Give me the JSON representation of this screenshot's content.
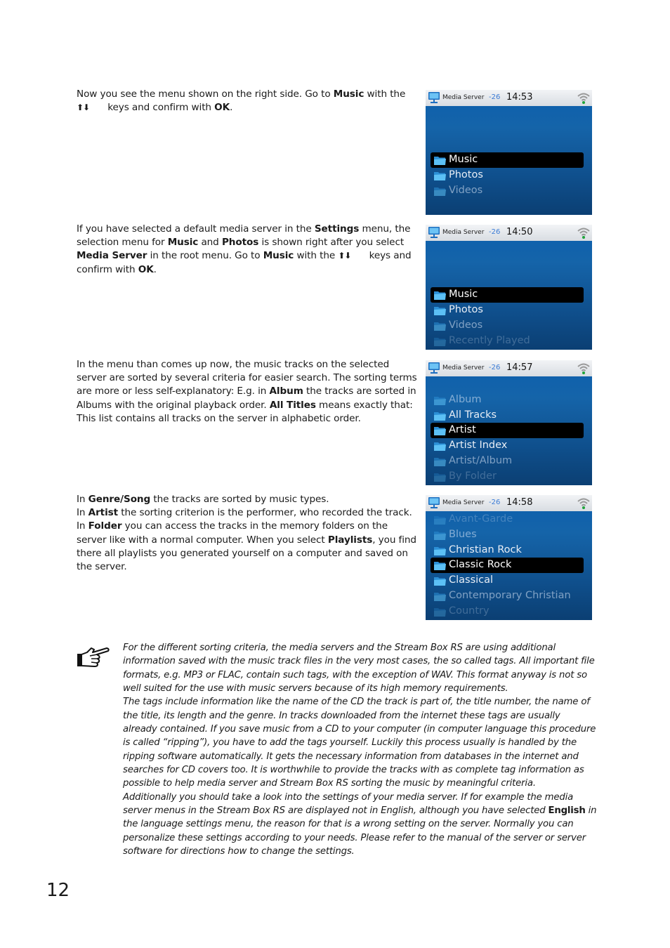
{
  "sections": [
    {
      "paragraph": [
        {
          "t": "Now you see the menu shown on the right side. Go to "
        },
        {
          "b": "Music"
        },
        {
          "t": " with the "
        },
        {
          "arrows": "↑↓"
        },
        {
          "t": " keys and confirm with "
        },
        {
          "b": "OK"
        },
        {
          "t": "."
        }
      ],
      "screen": {
        "title": "Media Server",
        "signal": "-26",
        "time": "14:53",
        "items": [
          {
            "label": "",
            "state": "blank"
          },
          {
            "label": "",
            "state": "blank"
          },
          {
            "label": "",
            "state": "blank"
          },
          {
            "label": "Music",
            "state": "selected"
          },
          {
            "label": "Photos",
            "state": "normal"
          },
          {
            "label": "Videos",
            "state": "dim1"
          }
        ]
      }
    },
    {
      "paragraph": [
        {
          "t": "If you have selected a default media server in the "
        },
        {
          "b": "Settings"
        },
        {
          "t": " menu, the selection menu for "
        },
        {
          "b": "Music"
        },
        {
          "t": " and "
        },
        {
          "b": "Photos"
        },
        {
          "t": " is shown right after you select "
        },
        {
          "b": "Media Server"
        },
        {
          "t": " in the root menu. Go to "
        },
        {
          "b": "Music"
        },
        {
          "t": " with the "
        },
        {
          "arrows": "↑↓"
        },
        {
          "t": " keys and confirm with "
        },
        {
          "b": "OK"
        },
        {
          "t": "."
        }
      ],
      "screen": {
        "title": "Media Server",
        "signal": "-26",
        "time": "14:50",
        "items": [
          {
            "label": "",
            "state": "blank"
          },
          {
            "label": "",
            "state": "blank"
          },
          {
            "label": "",
            "state": "blank"
          },
          {
            "label": "Music",
            "state": "selected"
          },
          {
            "label": "Photos",
            "state": "normal"
          },
          {
            "label": "Videos",
            "state": "dim1"
          },
          {
            "label": "Recently Played",
            "state": "dim2"
          }
        ]
      }
    },
    {
      "paragraph": [
        {
          "t": "In the menu than comes up now, the music tracks on the selected server are sorted by several criteria for easier search. The sorting terms are more or less self-explanatory: E.g. in "
        },
        {
          "b": "Album"
        },
        {
          "t": " the tracks are sorted in Albums with the original playback order. "
        },
        {
          "b": "All Titles"
        },
        {
          "t": " means exactly that: This list contains all tracks on the server in alphabetic order."
        }
      ],
      "screen": {
        "title": "Media Server",
        "signal": "-26",
        "time": "14:57",
        "items": [
          {
            "label": "",
            "state": "blank"
          },
          {
            "label": "Album",
            "state": "dim1"
          },
          {
            "label": "All Tracks",
            "state": "normal"
          },
          {
            "label": "Artist",
            "state": "selected"
          },
          {
            "label": "Artist Index",
            "state": "normal"
          },
          {
            "label": "Artist/Album",
            "state": "dim1"
          },
          {
            "label": "By Folder",
            "state": "dim2"
          }
        ]
      }
    },
    {
      "paragraph": [
        {
          "t": "In "
        },
        {
          "b": "Genre/Song"
        },
        {
          "t": " the tracks are sorted by music types."
        },
        {
          "br": true
        },
        {
          "t": "In "
        },
        {
          "b": "Artist"
        },
        {
          "t": " the sorting criterion is the performer, who recorded the track."
        },
        {
          "br": true
        },
        {
          "t": "In "
        },
        {
          "b": "Folder"
        },
        {
          "t": " you can access the tracks in the memory folders on the server like with a normal computer. When you select "
        },
        {
          "b": "Playlists"
        },
        {
          "t": ", you find there all playlists you generated yourself on a computer and saved on the server."
        }
      ],
      "screen": {
        "title": "Media Server",
        "signal": "-26",
        "time": "14:58",
        "items": [
          {
            "label": "Avant-Garde",
            "state": "dim2"
          },
          {
            "label": "Blues",
            "state": "dim1"
          },
          {
            "label": "Christian Rock",
            "state": "normal"
          },
          {
            "label": "Classic Rock",
            "state": "selected"
          },
          {
            "label": "Classical",
            "state": "normal"
          },
          {
            "label": "Contemporary Christian",
            "state": "dim1"
          },
          {
            "label": "Country",
            "state": "dim2"
          }
        ]
      }
    }
  ],
  "note": {
    "icon": "pointing-hand-icon",
    "paragraphs": [
      [
        {
          "t": "For the different sorting criteria, the media servers and the Stream Box RS are using additional information saved with the music track files in the very most cases, the so called tags. All important file formats, e.g. MP3 or FLAC, contain such tags, with the exception of WAV. This format anyway is not so well suited for the use with music servers because of its high memory requirements."
        }
      ],
      [
        {
          "t": "The tags include information like the name of the CD the track is part of, the title number, the name of the title, its length and the genre. In tracks downloaded from the internet these tags are usually already contained. If you save music from a CD to your computer (in computer language this procedure is called “ripping”), you have to add the tags yourself. Luckily this process usually is handled by the ripping software automatically. It gets the necessary information from databases in the internet and searches for CD covers too. It is worthwhile to provide the tracks with as complete tag information as possible to help media server and Stream Box RS sorting the music by meaningful criteria."
        }
      ],
      [
        {
          "t": "Additionally you should take a look into the settings of your media server. If for example the media server menus in the Stream Box RS are displayed not in English, although you have selected "
        },
        {
          "b": "English"
        },
        {
          "t": " in the language settings menu, the reason for that is a wrong setting on the server. Normally you can personalize these settings according to your needs. Please refer to the manual of the server or server software for directions how to change the settings."
        }
      ]
    ]
  },
  "page_number": "12",
  "colors": {
    "screen_blue": "#1564a9",
    "status_bar": "#e4e8ec",
    "signal_text": "#3a7bd5",
    "selected_bg": "#000000",
    "wifi_dot": "#1fa33a"
  }
}
